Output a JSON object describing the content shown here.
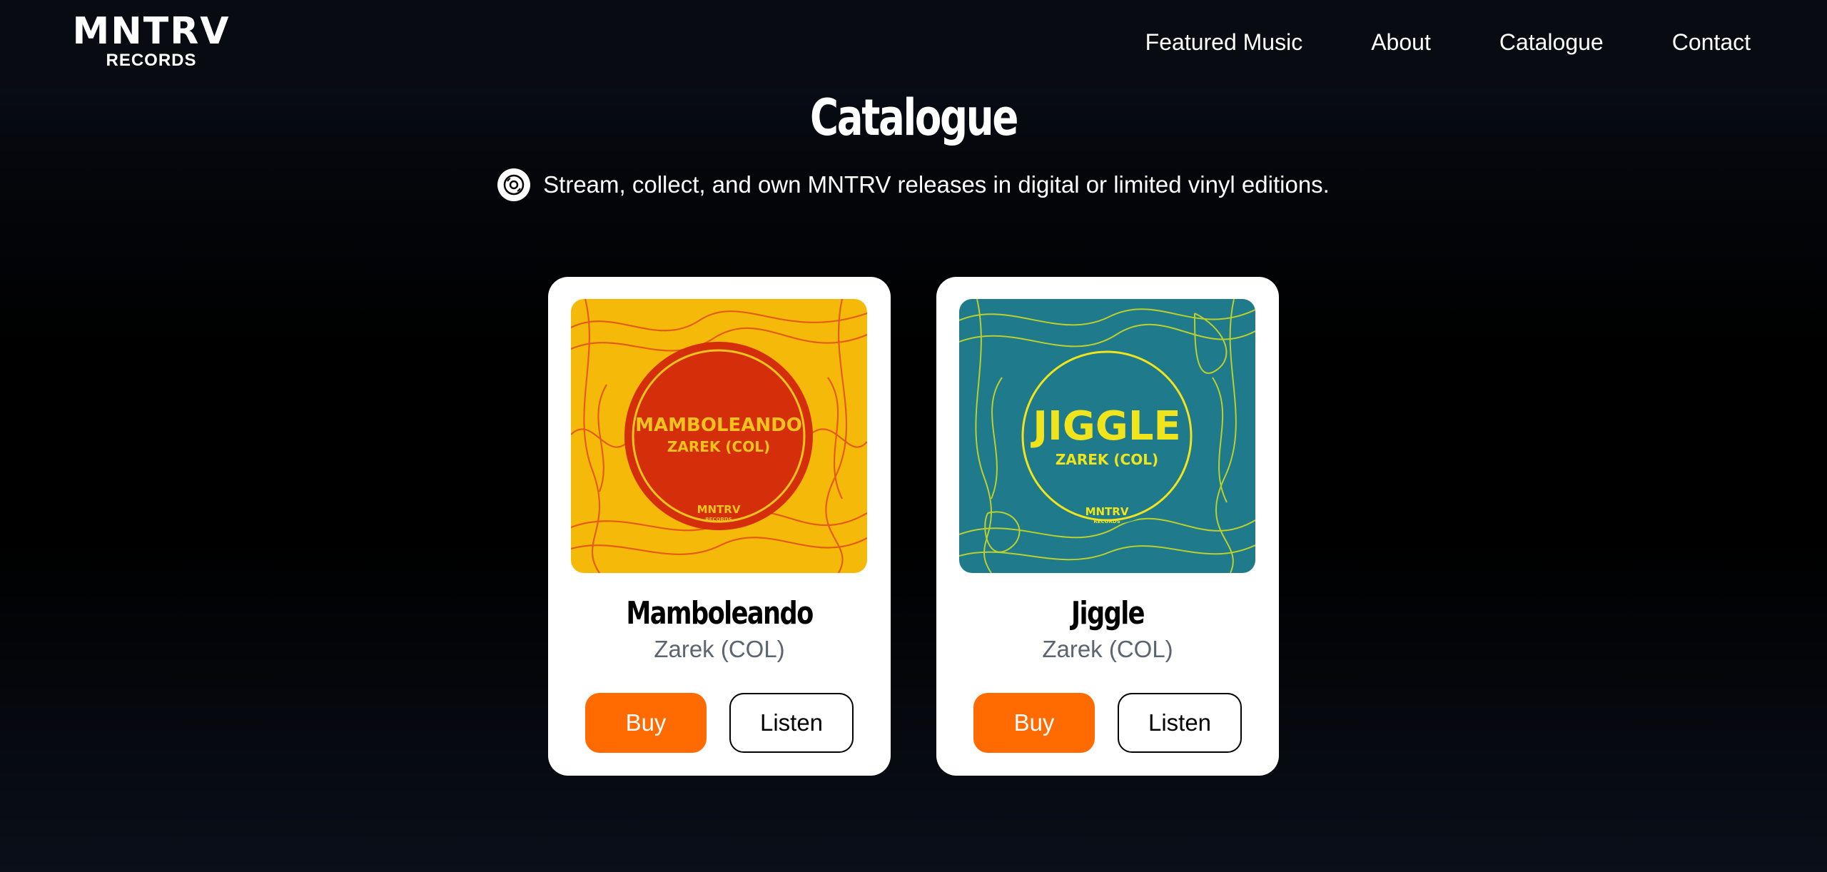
{
  "brand": {
    "logo_main": "MNTRV",
    "logo_sub": "RECORDS"
  },
  "nav": {
    "items": [
      "Featured Music",
      "About",
      "Catalogue",
      "Contact"
    ]
  },
  "page": {
    "title": "Catalogue",
    "subtitle": "Stream, collect, and own MNTRV releases in digital or limited vinyl editions.",
    "subtitle_icon": "vinyl-disc-icon"
  },
  "releases": [
    {
      "title": "Mamboleando",
      "artist": "Zarek (COL)",
      "cover_title": "MAMBOLEANDO",
      "cover_artist": "ZAREK (COL)",
      "cover_label": "MNTRV",
      "cover_label_sub": "RECORDS",
      "buy_label": "Buy",
      "listen_label": "Listen"
    },
    {
      "title": "Jiggle",
      "artist": "Zarek (COL)",
      "cover_title": "JIGGLE",
      "cover_artist": "ZAREK (COL)",
      "cover_label": "MNTRV",
      "cover_label_sub": "RECORDS",
      "buy_label": "Buy",
      "listen_label": "Listen"
    }
  ],
  "colors": {
    "accent": "#ff6b00",
    "cover1_bg": "#f5b90a",
    "cover1_circle": "#d42e0b",
    "cover1_text": "#f2c31a",
    "cover2_bg": "#1f7a8c",
    "cover2_text": "#f0e51c"
  }
}
